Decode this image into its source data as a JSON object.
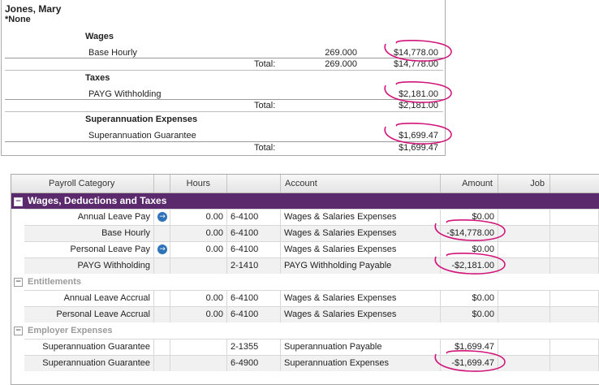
{
  "report": {
    "employee_name": "Jones, Mary",
    "subheading": "*None",
    "total_label": "Total:",
    "sections": [
      {
        "title": "Wages",
        "item_label": "Base Hourly",
        "hours": "269.000",
        "amount": "$14,778.00",
        "total_hours": "269.000",
        "total_amount": "$14,778.00"
      },
      {
        "title": "Taxes",
        "item_label": "PAYG Withholding",
        "hours": "",
        "amount": "$2,181.00",
        "total_hours": "",
        "total_amount": "$2,181.00"
      },
      {
        "title": "Superannuation Expenses",
        "item_label": "Superannuation Guarantee",
        "hours": "",
        "amount": "$1,699.47",
        "total_hours": "",
        "total_amount": "$1,699.47"
      }
    ]
  },
  "grid": {
    "columns": [
      "Payroll Category",
      "Hours",
      "Account",
      "Amount",
      "Job"
    ],
    "groups": [
      {
        "title": "Wages, Deductions and Taxes",
        "style": "purple",
        "rows": [
          {
            "category": "Annual Leave Pay",
            "arrow": true,
            "hours": "0.00",
            "account_no": "6-4100",
            "account_name": "Wages & Salaries Expenses",
            "amount": "$0.00"
          },
          {
            "category": "Base Hourly",
            "arrow": false,
            "hours": "0.00",
            "account_no": "6-4100",
            "account_name": "Wages & Salaries Expenses",
            "amount": "-$14,778.00"
          },
          {
            "category": "Personal Leave Pay",
            "arrow": true,
            "hours": "0.00",
            "account_no": "6-4100",
            "account_name": "Wages & Salaries Expenses",
            "amount": "$0.00"
          },
          {
            "category": "PAYG Withholding",
            "arrow": false,
            "hours": "",
            "account_no": "2-1410",
            "account_name": "PAYG Withholding Payable",
            "amount": "-$2,181.00"
          }
        ]
      },
      {
        "title": "Entitlements",
        "style": "gray",
        "rows": [
          {
            "category": "Annual Leave Accrual",
            "arrow": false,
            "hours": "0.00",
            "account_no": "6-4100",
            "account_name": "Wages & Salaries Expenses",
            "amount": "$0.00"
          },
          {
            "category": "Personal Leave Accrual",
            "arrow": false,
            "hours": "0.00",
            "account_no": "6-4100",
            "account_name": "Wages & Salaries Expenses",
            "amount": "$0.00"
          }
        ]
      },
      {
        "title": "Employer Expenses",
        "style": "gray",
        "rows": [
          {
            "category": "Superannuation Guarantee",
            "arrow": false,
            "hours": "",
            "account_no": "2-1355",
            "account_name": "Superannuation Payable",
            "amount": "$1,699.47"
          },
          {
            "category": "Superannuation Guarantee",
            "arrow": false,
            "hours": "",
            "account_no": "6-4900",
            "account_name": "Superannuation Expenses",
            "amount": "-$1,699.47"
          }
        ]
      }
    ]
  },
  "icons": {
    "collapse": "minus-box-icon",
    "drilldown": "arrow-circle-icon"
  },
  "colors": {
    "group_header": "#5b2a6d",
    "annotation": "#d1157a",
    "drilldown": "#2f73b8"
  }
}
